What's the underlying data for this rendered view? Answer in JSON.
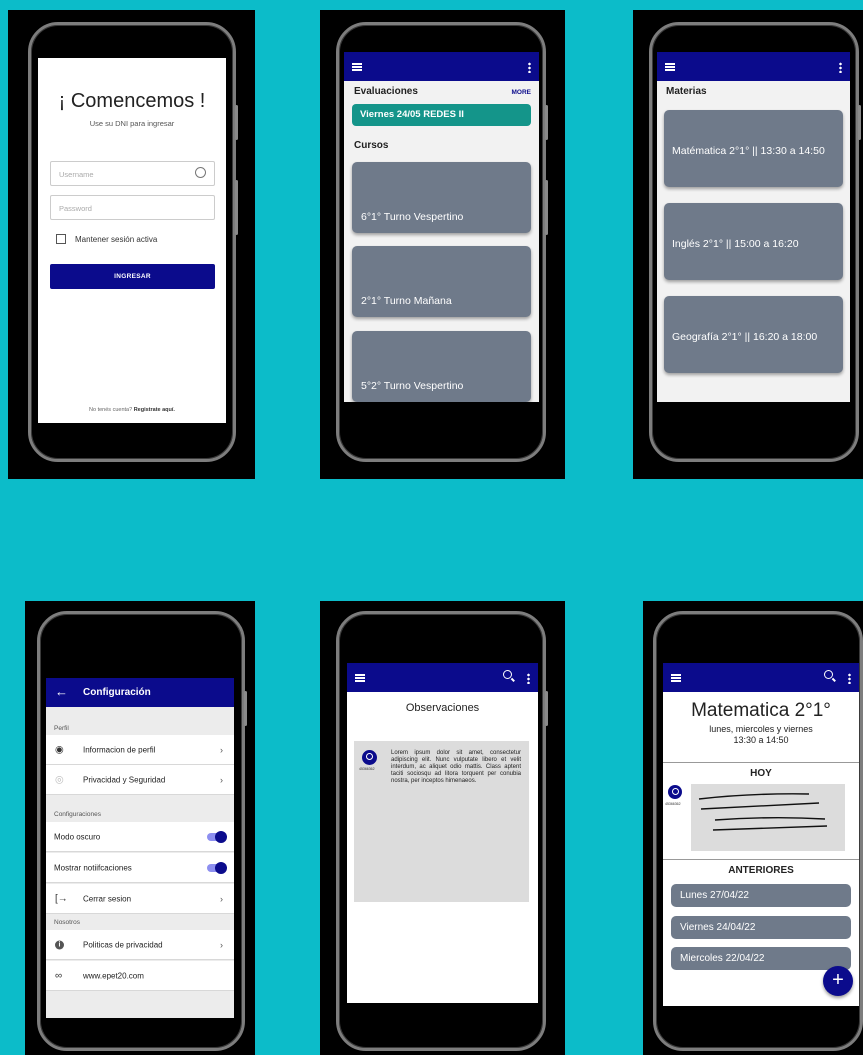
{
  "login": {
    "title": "¡ Comencemos !",
    "subtitle": "Use su DNI para ingresar",
    "username_placeholder": "Username",
    "password_placeholder": "Password",
    "remember_label": "Mantener sesión activa",
    "submit_label": "INGRESAR",
    "footer_prefix": "No tenés cuenta? ",
    "footer_link": "Registrate aquí."
  },
  "home": {
    "evaluaciones_title": "Evaluaciones",
    "more_label": "MORE",
    "evaluation_item": "Viernes 24/05  REDES II",
    "cursos_title": "Cursos",
    "cursos": [
      "6°1° Turno Vespertino",
      "2°1° Turno Mañana",
      "5°2° Turno Vespertino"
    ]
  },
  "materias": {
    "title": "Materias",
    "items": [
      "Matématica 2°1° || 13:30 a 14:50",
      "Inglés 2°1° || 15:00 a 16:20",
      "Geografía 2°1° || 16:20 a 18:00"
    ]
  },
  "config": {
    "title": "Configuración",
    "perfil_section": "Perfil",
    "perfil_info": "Informacion de perfil",
    "privacidad": "Privacidad y Seguridad",
    "config_section": "Configuraciones",
    "modo_oscuro": "Modo oscuro",
    "notificaciones": "Mostrar notiifcaciones",
    "cerrar_sesion": "Cerrar sesion",
    "nosotros_section": "Nosotros",
    "politicas": "Politicas de privacidad",
    "website": "www.epet20.com"
  },
  "observaciones": {
    "title": "Observaciones",
    "avatar_caption": "45366362",
    "body": "Lorem ipsum dolor sit amet, consectetur adipiscing elit. Nunc vulputate libero et velit interdum, ac aliquet odio mattis. Class aptent taciti sociosqu ad litora torquent per conubia nostra, per inceptos himenaeos."
  },
  "detalle": {
    "title": "Matematica 2°1°",
    "days": "lunes, miercoles y viernes",
    "time": "13:30 a 14:50",
    "hoy_label": "HOY",
    "avatar_caption": "45366362",
    "anteriores_label": "ANTERIORES",
    "anteriores": [
      "Lunes 27/04/22",
      "Viernes 24/04/22",
      "Miercoles 22/04/22"
    ],
    "fab_label": "+"
  },
  "colors": {
    "background": "#0cbcc9",
    "primary": "#0b0b8c",
    "accent": "#14958a",
    "card": "#6f7a8a"
  }
}
